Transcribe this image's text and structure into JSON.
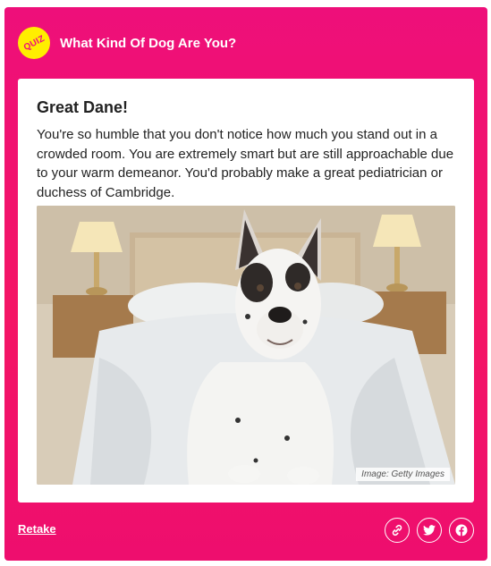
{
  "quiz": {
    "badge_text": "QUIZ",
    "title": "What Kind Of Dog Are You?"
  },
  "result": {
    "title": "Great Dane!",
    "description": "You're so humble that you don't notice how much you stand out in a crowded room. You are extremely smart but are still approachable due to your warm demeanor. You'd probably make a great pediatrician or duchess of Cambridge.",
    "image_credit": "Image: Getty Images"
  },
  "footer": {
    "retake_label": "Retake",
    "share_icons": [
      "link-icon",
      "twitter-icon",
      "facebook-icon"
    ]
  },
  "colors": {
    "accent": "#EE0F7A",
    "badge": "#FFEE00",
    "panel": "#FFFFFF",
    "text": "#222222"
  }
}
